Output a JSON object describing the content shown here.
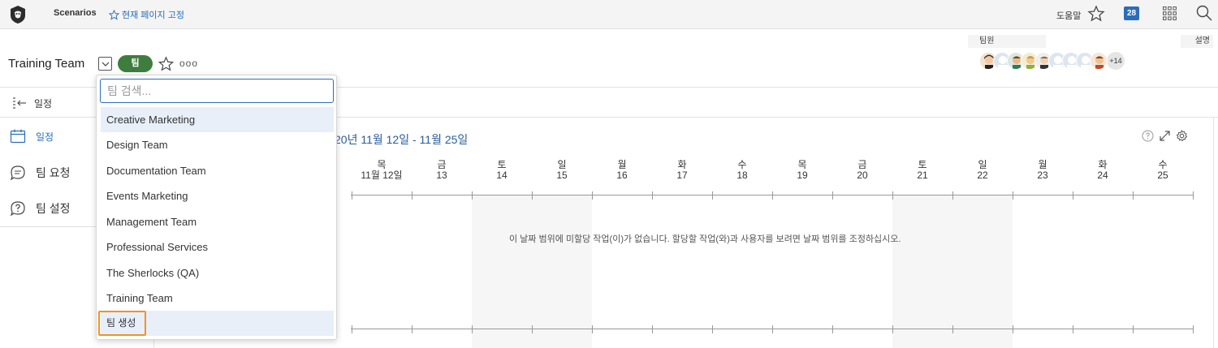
{
  "topbar": {
    "scenarios": "Scenarios",
    "pin_page": "현재 페이지 고정",
    "help": "도움말",
    "notifications_count": "28"
  },
  "header": {
    "title": "Training Team",
    "team_pill": "팀",
    "more": "ooo",
    "members_label": "팀원",
    "description_label": "설명",
    "members_extra": "+14"
  },
  "sidebar": {
    "collapse_label": "일정",
    "items": [
      {
        "label": "일정"
      },
      {
        "label": "팀 요청"
      },
      {
        "label": "팀 설정"
      }
    ]
  },
  "calendar": {
    "date_range": "20년 11월 12일 - 11월  25일",
    "days": [
      {
        "dow": "목",
        "num": "11월 12일"
      },
      {
        "dow": "금",
        "num": "13"
      },
      {
        "dow": "토",
        "num": "14"
      },
      {
        "dow": "일",
        "num": "15"
      },
      {
        "dow": "월",
        "num": "16"
      },
      {
        "dow": "화",
        "num": "17"
      },
      {
        "dow": "수",
        "num": "18"
      },
      {
        "dow": "목",
        "num": "19"
      },
      {
        "dow": "금",
        "num": "20"
      },
      {
        "dow": "토",
        "num": "21"
      },
      {
        "dow": "일",
        "num": "22"
      },
      {
        "dow": "월",
        "num": "23"
      },
      {
        "dow": "화",
        "num": "24"
      },
      {
        "dow": "수",
        "num": "25"
      }
    ],
    "empty_message": "이 날짜 범위에 미할당 작업(이)가 없습니다.   할당할 작업(와)과 사용자를 보려면 날짜 범위를 조정하십시오."
  },
  "dropdown": {
    "search_placeholder": "팀 검색...",
    "items": [
      "Creative Marketing",
      "Design Team",
      "Documentation Team",
      "Events Marketing",
      "Management Team",
      "Professional  Services",
      "The Sherlocks (QA)",
      "Training Team"
    ],
    "create_label": "팀 생성"
  },
  "colors": {
    "accent": "#2a6ebb",
    "team_pill": "#3f7d3f",
    "highlight_border": "#f39221"
  }
}
